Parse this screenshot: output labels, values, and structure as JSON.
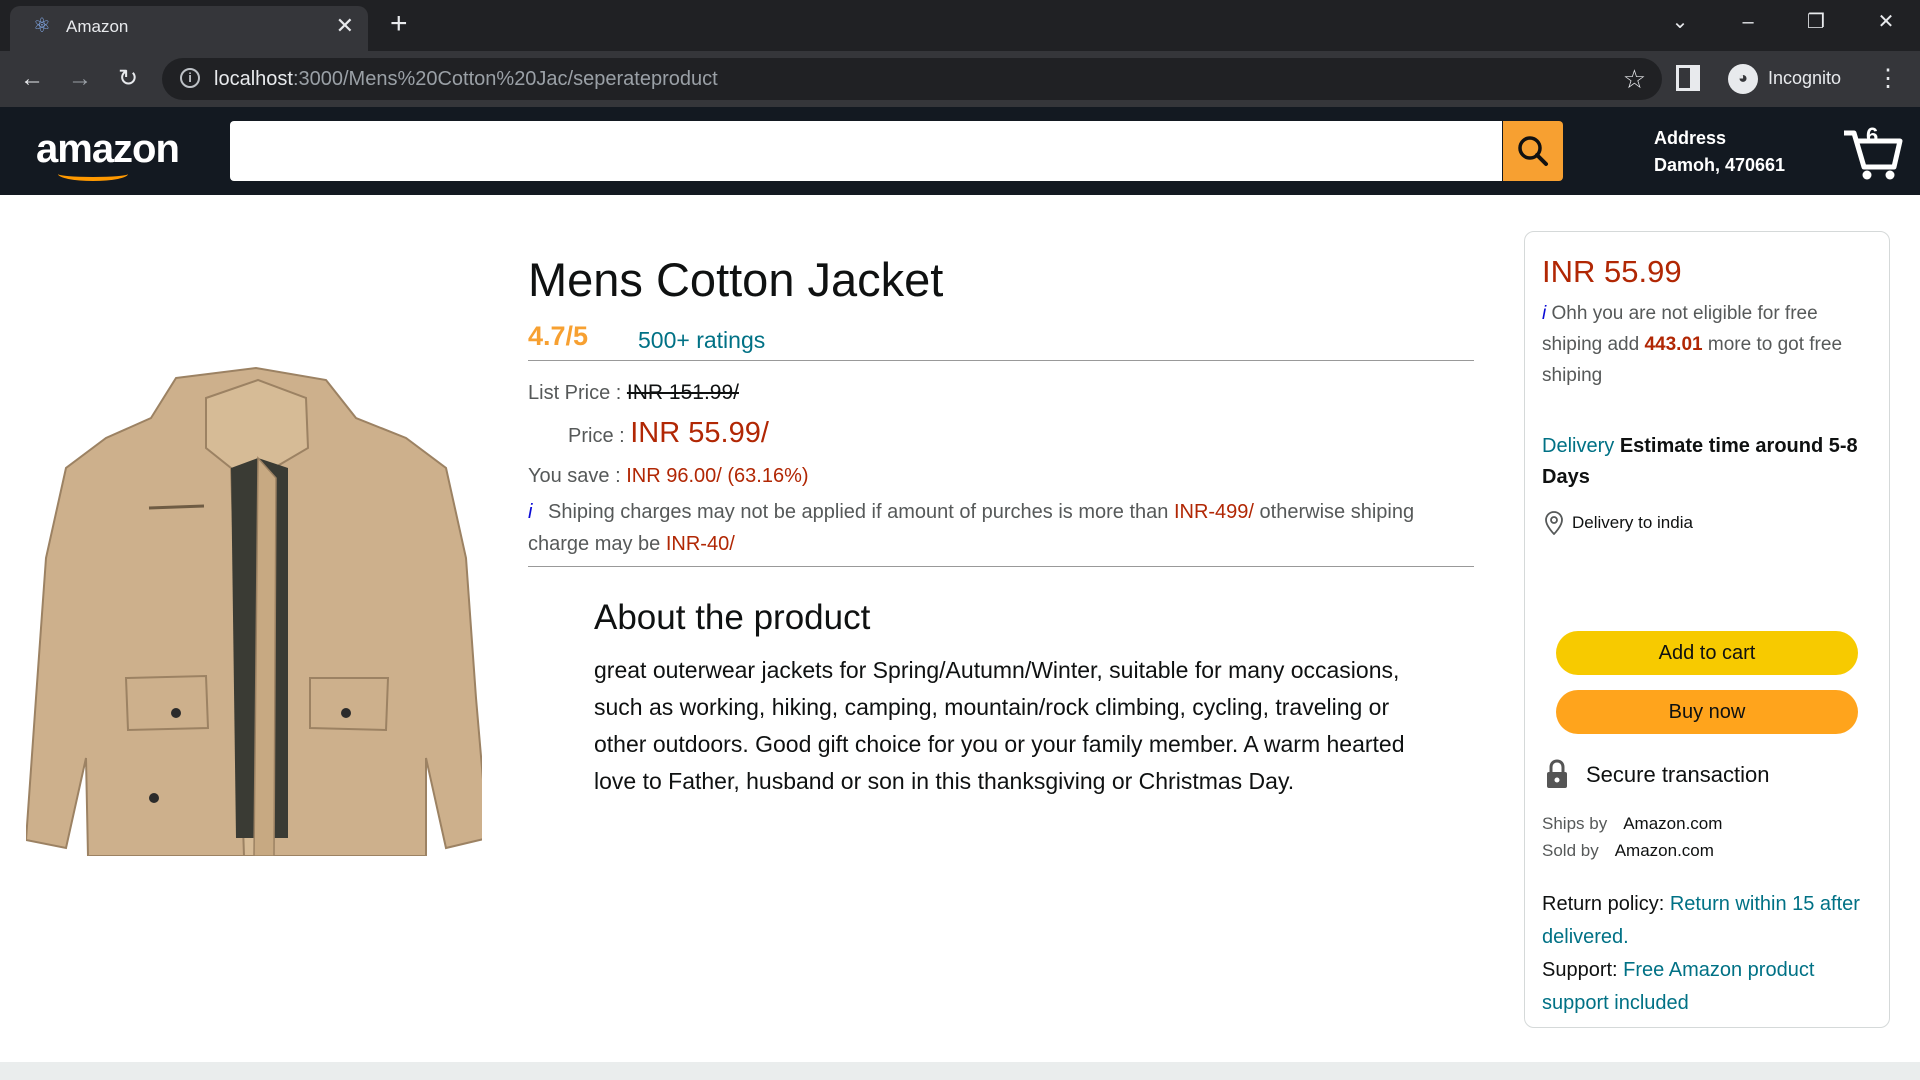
{
  "browser": {
    "tab_title": "Amazon",
    "url_host": "localhost",
    "url_rest": ":3000/Mens%20Cotton%20Jac/seperateproduct",
    "profile_label": "Incognito"
  },
  "header": {
    "logo": "amazon",
    "search_placeholder": "",
    "address_label": "Address",
    "address_value": "Damoh, 470661",
    "cart_count": "6"
  },
  "product": {
    "title": "Mens Cotton Jacket",
    "rating": "4.7/5",
    "ratings_count": "500+ ratings",
    "list_price_label": "List Price :",
    "list_price": "INR 151.99/",
    "price_label": "Price :",
    "price": "INR 55.99/",
    "save_label": "You save :",
    "save_value": "INR 96.00/ (63.16%)",
    "ship_icon": "i",
    "ship_text_1": "Shiping charges may not be applied if amount of purches is more than",
    "ship_threshold": "INR-499/",
    "ship_text_2": "otherwise shiping charge may be",
    "ship_charge": "INR-40/",
    "about_title": "About the product",
    "about_text": "great outerwear jackets for Spring/Autumn/Winter, suitable for many occasions, such as working, hiking, camping, mountain/rock climbing, cycling, traveling or other outdoors. Good gift choice for you or your family member. A warm hearted love to Father, husband or son in this thanksgiving or Christmas Day."
  },
  "buy_box": {
    "price": "INR 55.99",
    "ship_icon": "i",
    "ship_text_1": "Ohh you are not eligible for free shiping add",
    "ship_amount": "443.01",
    "ship_text_2": "more to got free shiping",
    "delivery_link": "Delivery",
    "delivery_estimate": "Estimate time around 5-8 Days",
    "delivery_location": "Delivery to india",
    "add_to_cart": "Add to cart",
    "buy_now": "Buy now",
    "secure": "Secure transaction",
    "ships_by_label": "Ships by",
    "ships_by": "Amazon.com",
    "sold_by_label": "Sold by",
    "sold_by": "Amazon.com",
    "return_label": "Return policy:",
    "return_value": "Return within 15 after delivered.",
    "support_label": "Support:",
    "support_value": "Free Amazon product support included"
  },
  "colors": {
    "header_bg": "#131921",
    "accent_orange": "#f7a031",
    "price_red": "#b12704",
    "link_teal": "#007185",
    "cart_yellow": "#f7ca00",
    "buy_orange": "#ffa41c"
  }
}
